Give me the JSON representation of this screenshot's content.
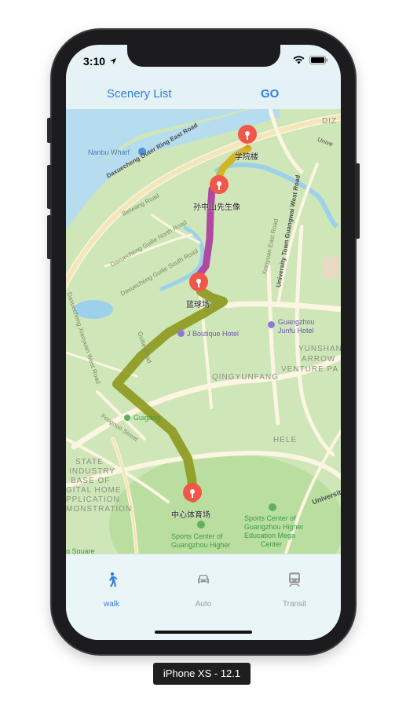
{
  "status_bar": {
    "time": "3:10"
  },
  "nav": {
    "left_label": "Scenery List",
    "right_label": "GO"
  },
  "map": {
    "pins": [
      {
        "label": "学院楼"
      },
      {
        "label": "孙中山先生像"
      },
      {
        "label": "篮球场"
      },
      {
        "label": "中心体育场"
      }
    ],
    "labels": {
      "nanbu_wharf": "Nanbu Wharf",
      "outer_ring": "Daxuecheng Outer Ring East Road",
      "beiwang": "Beiwang Road",
      "guilie_north": "Daxuecheng Guilie North Road",
      "guilie_south": "Daxuecheng Guilie South Road",
      "xiaoyuan_east": "Xiaoyuan East Road",
      "guangwai": "University Town Guangwai West Road",
      "j_boutique": "J Boutique Hotel",
      "junfu_1": "Guangzhou",
      "junfu_2": "Junfu Hotel",
      "qingyunfang": "QINGYUNFANG",
      "yunshan_1": "YUNSHAN",
      "yunshan_2": "ARROW",
      "yunshan_3": "VENTURE PA",
      "xiaoyuan_west": "Daxuecheng Xiaoyuan West Road",
      "guilie_road": "Guilie Road",
      "guigang": "Guigang",
      "fengnuo": "Fengnuo Street",
      "hele": "HELE",
      "state_1": "STATE",
      "state_2": "INDUSTRY",
      "state_3": "BASE OF",
      "state_4": "GITAL HOME",
      "state_5": "PPLICATION",
      "state_6": "MONSTRATION",
      "sports_1": "Sports Center of",
      "sports_2": "Guangzhou Higher",
      "sports_edu_1": "Sports Center of",
      "sports_edu_2": "Guangzhou Higher",
      "sports_edu_3": "Education Mega",
      "sports_edu_4": "Center",
      "university": "University",
      "dizi": "DIZ",
      "university_top": "Unive",
      "square": "g Square"
    }
  },
  "tabs": [
    {
      "label": "walk",
      "icon": "walk-icon",
      "active": true
    },
    {
      "label": "Auto",
      "icon": "car-icon",
      "active": false
    },
    {
      "label": "Transit",
      "icon": "train-icon",
      "active": false
    }
  ],
  "device_caption": "iPhone XS - 12.1",
  "colors": {
    "accent": "#2f7ddb",
    "pin": "#f0574a",
    "route_olive": "#8f9a1f",
    "route_magenta": "#b04aa0",
    "route_yellow": "#d2b526"
  }
}
